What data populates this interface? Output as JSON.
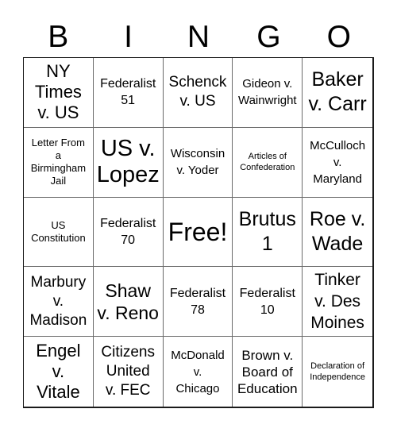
{
  "header": {
    "letters": [
      "B",
      "I",
      "N",
      "G",
      "O"
    ]
  },
  "cells": [
    [
      "NY\nTimes\nv. US",
      "Federalist\n51",
      "Schenck\nv. US",
      "Gideon v.\nWainwright",
      "Baker\nv. Carr"
    ],
    [
      "Letter From\na\nBirmingham\nJail",
      "US v.\nLopez",
      "Wisconsin\nv. Yoder",
      "Articles of\nConfederation",
      "McCulloch\nv.\nMaryland"
    ],
    [
      "US\nConstitution",
      "Federalist\n70",
      "Free!",
      "Brutus\n1",
      "Roe v.\nWade"
    ],
    [
      "Marbury\nv.\nMadison",
      "Shaw\nv. Reno",
      "Federalist\n78",
      "Federalist\n10",
      "Tinker\nv. Des\nMoines"
    ],
    [
      "Engel\nv.\nVitale",
      "Citizens\nUnited\nv. FEC",
      "McDonald\nv.\nChicago",
      "Brown v.\nBoard of\nEducation",
      "Declaration of\nIndependence"
    ]
  ]
}
